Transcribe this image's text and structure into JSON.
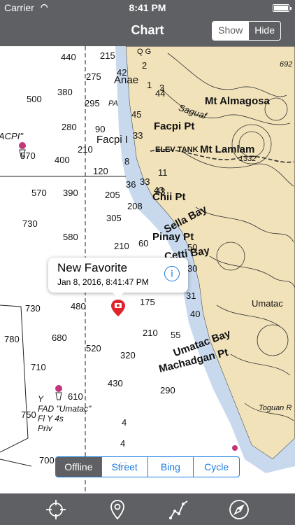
{
  "status": {
    "carrier": "Carrier",
    "time": "8:41 PM"
  },
  "nav": {
    "title": "Chart",
    "show_label": "Show",
    "hide_label": "Hide"
  },
  "map": {
    "depths": [
      "440",
      "215",
      "500",
      "380",
      "275",
      "295",
      "280",
      "90",
      "570",
      "400",
      "210",
      "120",
      "570",
      "390",
      "205",
      "36",
      "33",
      "730",
      "580",
      "305",
      "208",
      "210",
      "60",
      "730",
      "480",
      "175",
      "680",
      "210",
      "55",
      "780",
      "520",
      "320",
      "710",
      "430",
      "290",
      "610",
      "750",
      "700",
      "4",
      "47",
      "30",
      "40",
      "43",
      "45",
      "42",
      "44",
      "11",
      "8",
      "3",
      "1",
      "2",
      "33",
      "31",
      "43",
      "4",
      "50"
    ],
    "places": {
      "mt_almagosa": "Mt Almagosa",
      "mt_lamlam": "Mt Lamlam",
      "facpi_pt": "Facpi Pt",
      "elev_tank": "ELEV TANK",
      "chii_pt": "Chii Pt",
      "sella_bay": "Sella Bay",
      "pinay_pt": "Pinay Pt",
      "cetti_bay": "Cetti Bay",
      "umatac_bay": "Umatac Bay",
      "machadgan_pt": "Machadgan Pt",
      "umatac": "Umatac",
      "anae": "Anae",
      "facpi_i": "Facpi I",
      "facpi_left": "ACPI\"",
      "height_1332": "1332",
      "height_692": "692",
      "saguaf": "Saguaf",
      "toguan": "Toguan R",
      "pa": "PA",
      "qg": "Q G"
    },
    "buoy_label": [
      "Y",
      "FAD \"Umatac\"",
      "Fl Y 4s",
      "Priv"
    ]
  },
  "callout": {
    "title": "New Favorite",
    "subtitle": "Jan 8, 2016, 8:41:47 PM",
    "info": "i"
  },
  "maptype": {
    "offline": "Offline",
    "street": "Street",
    "bing": "Bing",
    "cycle": "Cycle",
    "selected": "Offline"
  },
  "toolbar": {
    "icons": [
      "locate-icon",
      "pin-icon",
      "route-icon",
      "compass-icon"
    ]
  },
  "colors": {
    "bar": "#5e6063",
    "accent": "#1a7ce2",
    "land": "#f1e2b9",
    "shallow": "#c8d9ee",
    "pin": "#e0242b"
  }
}
